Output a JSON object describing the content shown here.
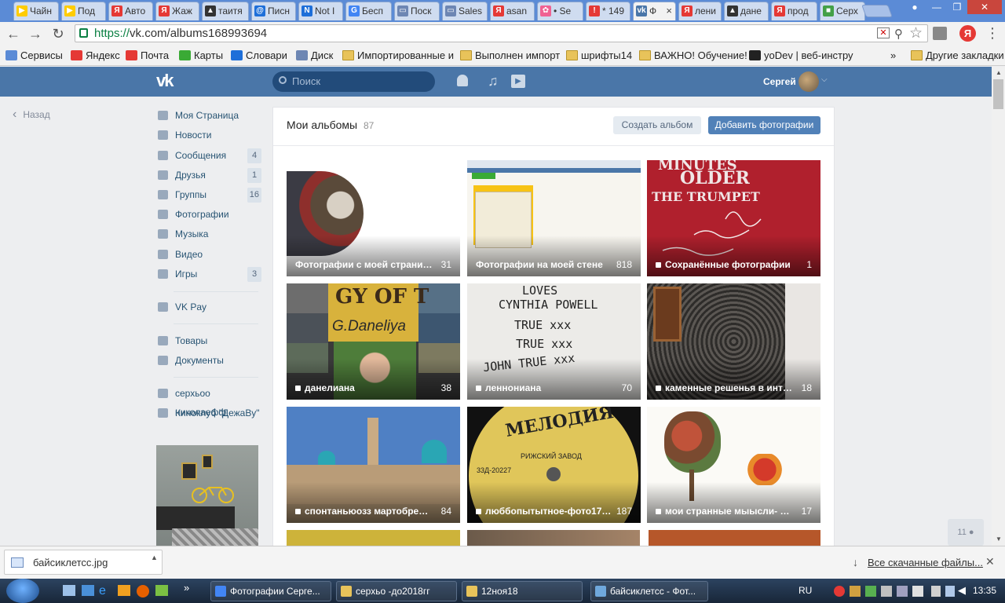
{
  "browser": {
    "tabs": [
      {
        "label": "Чайн",
        "fav": "▶",
        "color": "#ffcc00"
      },
      {
        "label": "Под",
        "fav": "▶",
        "color": "#ffcc00"
      },
      {
        "label": "Авто",
        "fav": "Я",
        "color": "#e53935"
      },
      {
        "label": "Жаж",
        "fav": "Я",
        "color": "#e53935"
      },
      {
        "label": "таитя",
        "fav": "▲",
        "color": "#333"
      },
      {
        "label": "Писн",
        "fav": "@",
        "color": "#1e6fd9"
      },
      {
        "label": "Not I",
        "fav": "N",
        "color": "#1e6fd9"
      },
      {
        "label": "Бесп",
        "fav": "G",
        "color": "#4285f4"
      },
      {
        "label": "Поск",
        "fav": "▭",
        "color": "#6d86b3"
      },
      {
        "label": "Sales",
        "fav": "▭",
        "color": "#6d86b3"
      },
      {
        "label": "asan",
        "fav": "Я",
        "color": "#e53935"
      },
      {
        "label": "• Se",
        "fav": "✿",
        "color": "#f06292"
      },
      {
        "label": "* 149",
        "fav": "!",
        "color": "#e53935"
      },
      {
        "label": "Ф",
        "fav": "vk",
        "color": "#4a76a8"
      },
      {
        "label": "лени",
        "fav": "Я",
        "color": "#e53935"
      },
      {
        "label": "дане",
        "fav": "▲",
        "color": "#333"
      },
      {
        "label": "прод",
        "fav": "Я",
        "color": "#e53935"
      },
      {
        "label": "Серх",
        "fav": "■",
        "color": "#43a047"
      }
    ],
    "url_proto": "https://",
    "url_rest": "vk.com/albums168993694",
    "bookmarks": [
      {
        "label": "Сервисы",
        "icon": "apps-grid-icon"
      },
      {
        "label": "Яндекс",
        "icon": "yandex-icon"
      },
      {
        "label": "Почта",
        "icon": "mail-icon"
      },
      {
        "label": "Карты",
        "icon": "maps-icon"
      },
      {
        "label": "Словари",
        "icon": "dictionary-icon"
      },
      {
        "label": "Диск",
        "icon": "disk-icon"
      },
      {
        "label": "Импортированные и",
        "icon": "folder-icon"
      },
      {
        "label": "Выполнен импорт",
        "icon": "folder-icon"
      },
      {
        "label": "шрифты14",
        "icon": "folder-icon"
      },
      {
        "label": "ВАЖНО! Обучение!",
        "icon": "folder-icon"
      },
      {
        "label": "yoDev | веб-инстру",
        "icon": "yodev-icon"
      }
    ],
    "other_bookmarks": "Другие закладки"
  },
  "vk": {
    "search_placeholder": "Поиск",
    "user_name": "Сергей",
    "back_label": "Назад",
    "menu": [
      {
        "label": "Моя Страница",
        "badge": ""
      },
      {
        "label": "Новости",
        "badge": ""
      },
      {
        "label": "Сообщения",
        "badge": "4"
      },
      {
        "label": "Друзья",
        "badge": "1"
      },
      {
        "label": "Группы",
        "badge": "16"
      },
      {
        "label": "Фотографии",
        "badge": ""
      },
      {
        "label": "Музыка",
        "badge": ""
      },
      {
        "label": "Видео",
        "badge": ""
      },
      {
        "label": "Игры",
        "badge": "3"
      }
    ],
    "menu2": [
      "VK Pay"
    ],
    "menu3": [
      "Товары",
      "Документы"
    ],
    "menu4": [
      "серхьоо николаефф",
      "Киноклуб \"ДежаВу\""
    ],
    "page_title": "Мои альбомы",
    "album_count": "87",
    "create_album": "Создать альбом",
    "add_photos": "Добавить фотографии",
    "albums": [
      {
        "title": "Фотографии с моей страницы",
        "count": "31",
        "locked": false
      },
      {
        "title": "Фотографии на моей стене",
        "count": "818",
        "locked": false
      },
      {
        "title": "Сохранённые фотографии",
        "count": "1",
        "locked": true
      },
      {
        "title": "данелиана",
        "count": "38",
        "locked": true
      },
      {
        "title": "леннониана",
        "count": "70",
        "locked": true
      },
      {
        "title": "каменные решенья в интерьере...",
        "count": "18",
        "locked": true
      },
      {
        "title": "спонтаньюозз мартобревскоо...",
        "count": "84",
        "locked": true
      },
      {
        "title": "люббопытытное-фото17-окт...",
        "count": "187",
        "locked": true
      },
      {
        "title": "мои странные мыысли- платт...",
        "count": "17",
        "locked": true
      }
    ],
    "album_texts": {
      "trumpet_line1": "MINUTES",
      "trumpet_line2": "OLDER",
      "trumpet_line3": "THE TRUMPET",
      "danelia_sign": "G.Daneliya",
      "danelia_top": "GY OF T",
      "lennon_1": "LOVES",
      "lennon_2": "CYNTHIA POWELL",
      "lennon_3": "TRUE xxx",
      "lennon_4": "TRUE xxx",
      "lennon_5": "JOHN TRUE xxx",
      "melodiya": "МЕЛОДИЯ",
      "melodiya_sub": "РИЖСКИЙ ЗАВОД",
      "melodiya_code": "33Д-20227"
    },
    "online_count": "11"
  },
  "download": {
    "file": "байсиклетсс.jpg",
    "all": "Все скачанные файлы..."
  },
  "taskbar": {
    "items": [
      {
        "label": "Фотографии Серге...",
        "color": "#4285f4"
      },
      {
        "label": "серхьо -до2018гг",
        "color": "#e8c35a"
      },
      {
        "label": "12ноя18",
        "color": "#e8c35a"
      },
      {
        "label": "байсиклетсс - Фот...",
        "color": "#6fa8dc"
      }
    ],
    "lang": "RU",
    "time": "13:35"
  },
  "colors": {
    "vk_blue": "#4a76a8",
    "button_primary": "#5181b8",
    "link": "#285473"
  }
}
